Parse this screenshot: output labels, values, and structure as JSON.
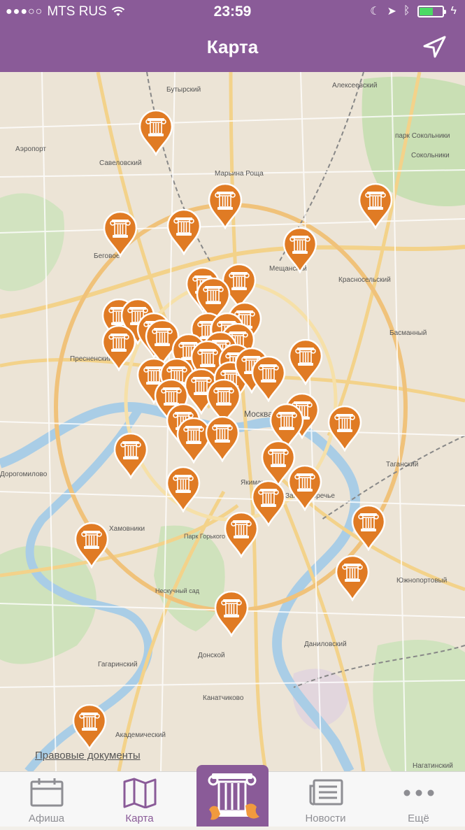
{
  "status_bar": {
    "carrier": "MTS RUS",
    "time": "23:59"
  },
  "header": {
    "title": "Карта"
  },
  "map": {
    "legal_link": "Правовые документы",
    "labels": [
      {
        "text": "Бутырский"
      },
      {
        "text": "Алексеевский"
      },
      {
        "text": "Аэропорт"
      },
      {
        "text": "Савеловский"
      },
      {
        "text": "Марьина Роща"
      },
      {
        "text": "парк Сокольники"
      },
      {
        "text": "Сокольники"
      },
      {
        "text": "Беговое"
      },
      {
        "text": "Мещанский"
      },
      {
        "text": "Красносельский"
      },
      {
        "text": "Пресненский"
      },
      {
        "text": "Басманный"
      },
      {
        "text": "Москва"
      },
      {
        "text": "Таганский"
      },
      {
        "text": "Дорогомилово"
      },
      {
        "text": "Хамовники"
      },
      {
        "text": "Замоскворечье"
      },
      {
        "text": "Якиманка"
      },
      {
        "text": "Южнопортовый"
      },
      {
        "text": "Донской"
      },
      {
        "text": "Даниловский"
      },
      {
        "text": "Гагаринский"
      },
      {
        "text": "Канатчиково"
      },
      {
        "text": "Академический"
      },
      {
        "text": "Нагатинский"
      },
      {
        "text": "Парк Горького"
      },
      {
        "text": "Нескучный сад"
      }
    ]
  },
  "tabs": [
    {
      "label": "Афиша",
      "icon": "calendar-icon"
    },
    {
      "label": "Карта",
      "icon": "map-icon"
    },
    {
      "label": "",
      "icon": "column-icon"
    },
    {
      "label": "Новости",
      "icon": "newspaper-icon"
    },
    {
      "label": "Ещё",
      "icon": "more-dots-icon"
    }
  ],
  "colors": {
    "brand": "#8a5b98",
    "pin": "#e07b24",
    "tab_inactive": "#8e8e93"
  }
}
